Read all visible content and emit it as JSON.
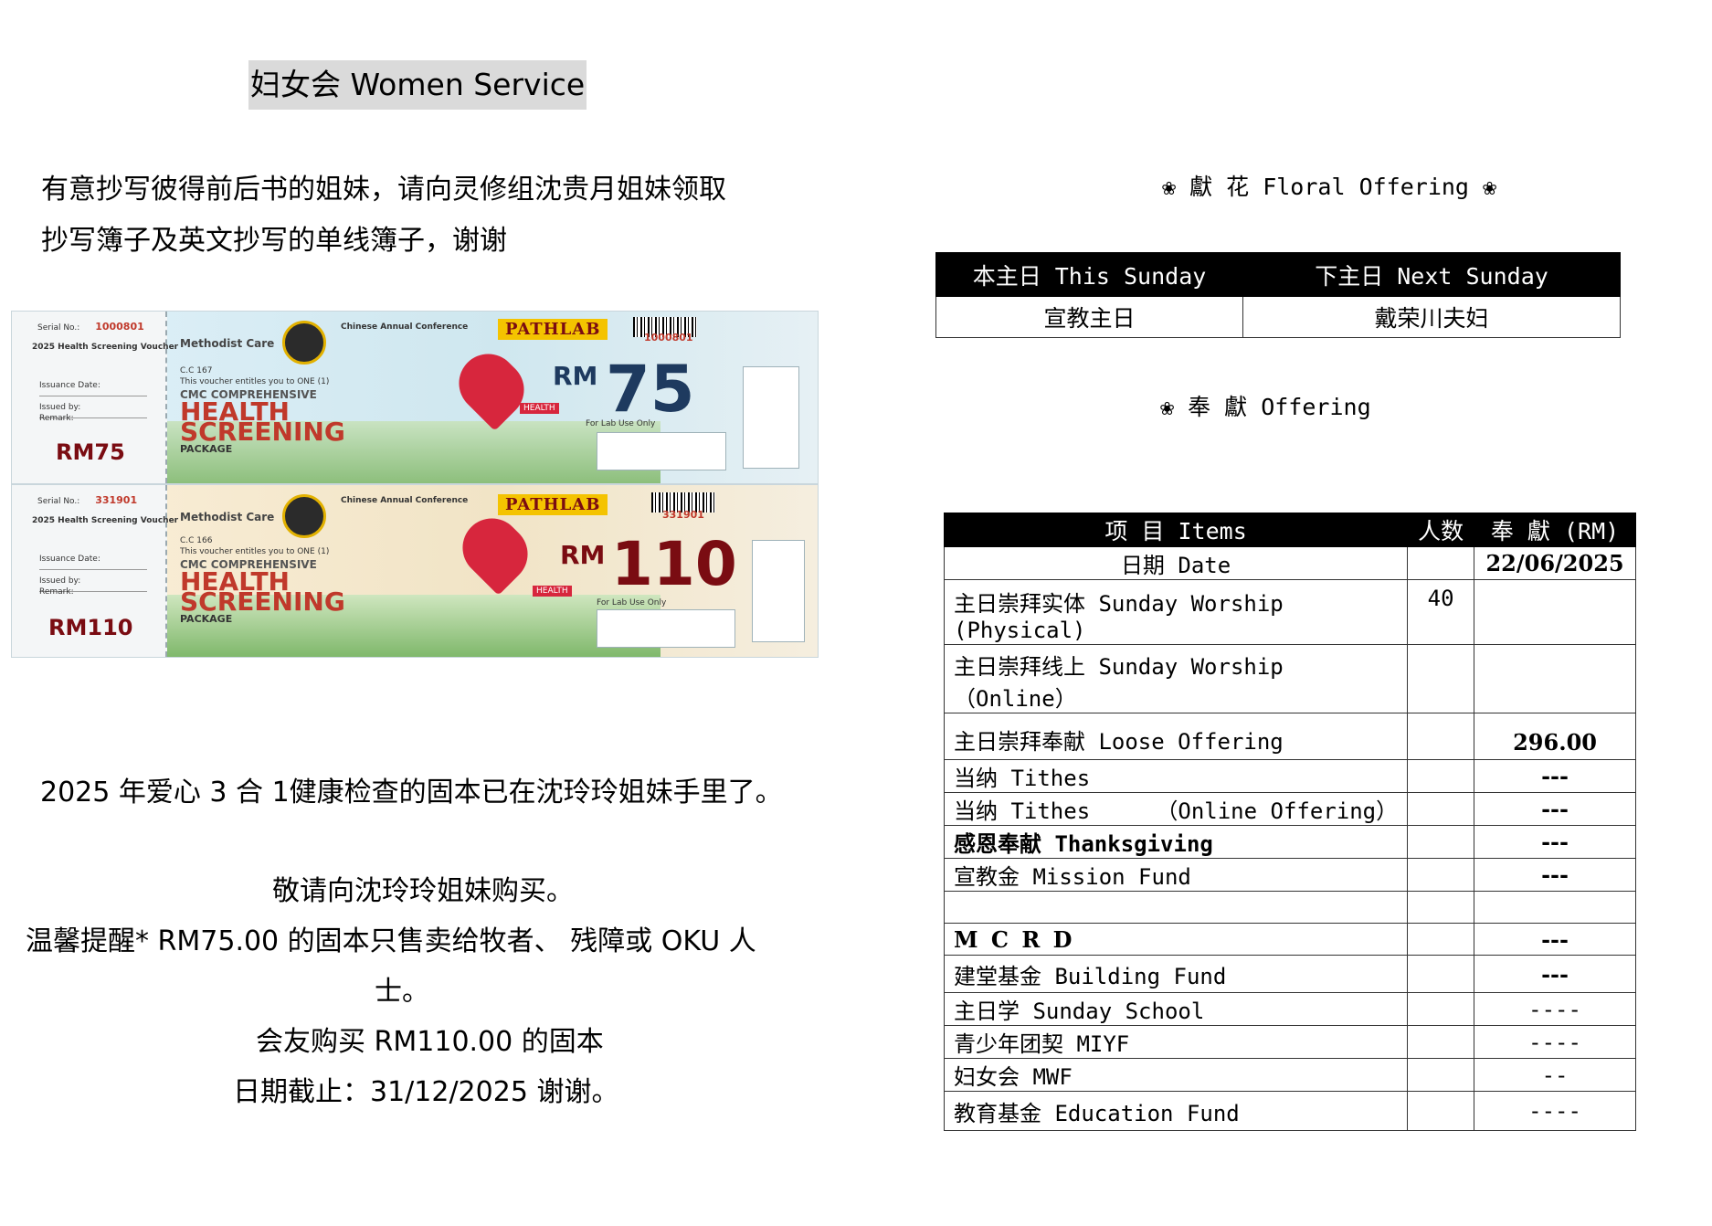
{
  "women_service": {
    "title": "妇女会  Women Service",
    "notice_line1": "有意抄写彼得前后书的姐妹，请向灵修组沈贵月姐妹领取",
    "notice_line2": "抄写簿子及英文抄写的单线簿子，谢谢",
    "health_line": "2025 年爱心  3  合  1健康检查的固本已在沈玲玲姐妹手里了。",
    "buy_line": "敬请向沈玲玲姐妹购买。",
    "reminder_line1": "温馨提醒* RM75.00 的固本只售卖给牧者、  残障或  OKU  人",
    "reminder_line2": "士。",
    "member_line": "会友购买  RM110.00  的固本",
    "deadline_line": "日期截止：31/12/2025     谢谢。"
  },
  "vouchers": [
    {
      "serial_label": "Serial No.:",
      "serial": "1000801",
      "voucher_title": "2025 Health Screening Voucher",
      "stub_fields": [
        "Issuance Date:",
        "Issued by:",
        "Remark:"
      ],
      "brand": "Methodist Care",
      "conference": "Chinese Annual Conference",
      "code": "C.C 167",
      "entitles": "This voucher entitles you to ONE (1)",
      "cmc": "CMC COMPREHENSIVE",
      "health": "HEALTH",
      "screening": "SCREENING",
      "package": "PACKAGE",
      "lab": "PATHLAB",
      "rm": "RM",
      "amount": "75",
      "stub_amount": "RM75",
      "serial_right": "1000801",
      "lab_use": "For Lab Use Only",
      "badge": "HEALTH"
    },
    {
      "serial_label": "Serial No.:",
      "serial": "331901",
      "voucher_title": "2025 Health Screening Voucher",
      "stub_fields": [
        "Issuance Date:",
        "Issued by:",
        "Remark:"
      ],
      "brand": "Methodist Care",
      "conference": "Chinese Annual Conference",
      "code": "C.C 166",
      "entitles": "This voucher entitles you to ONE (1)",
      "cmc": "CMC COMPREHENSIVE",
      "health": "HEALTH",
      "screening": "SCREENING",
      "package": "PACKAGE",
      "lab": "PATHLAB",
      "rm": "RM",
      "amount": "110",
      "stub_amount": "RM110",
      "serial_right": "331901",
      "lab_use": "For Lab Use Only",
      "badge": "HEALTH"
    }
  ],
  "floral": {
    "heading": "❀ 獻 花 Floral Offering ❀",
    "headers": [
      "本主日 This Sunday",
      "下主日 Next Sunday"
    ],
    "values": [
      "宣教主日",
      "戴荣川夫妇"
    ]
  },
  "offering": {
    "heading": "❀  奉 獻  Offering",
    "headers": [
      "项 目 Items",
      "人数",
      "奉 獻 (RM)"
    ],
    "rows": [
      {
        "item": "日期 Date",
        "count": "",
        "amount": "22/06/2025"
      },
      {
        "item": "主日崇拜实体 Sunday Worship (Physical)",
        "count": "40",
        "amount": ""
      },
      {
        "item": "主日崇拜线上 Sunday Worship （Online）",
        "count": "",
        "amount": ""
      },
      {
        "item": "主日崇拜奉献 Loose Offering",
        "count": "",
        "amount": "296.00"
      },
      {
        "item": "当纳 Tithes",
        "count": "",
        "amount": "---"
      },
      {
        "item": "当纳 Tithes     （Online Offering）",
        "count": "",
        "amount": "---"
      },
      {
        "item": "感恩奉献 Thanksgiving",
        "count": "",
        "amount": "---"
      },
      {
        "item": "宣教金 Mission Fund",
        "count": "",
        "amount": "---"
      },
      {
        "item": "",
        "count": "",
        "amount": ""
      },
      {
        "item": "M C R D",
        "count": "",
        "amount": "---"
      },
      {
        "item": "建堂基金 Building Fund",
        "count": "",
        "amount": "---"
      },
      {
        "item": "主日学 Sunday School",
        "count": "",
        "amount": "----"
      },
      {
        "item": "青少年团契 MIYF",
        "count": "",
        "amount": "----"
      },
      {
        "item": "妇女会 MWF",
        "count": "",
        "amount": "--"
      },
      {
        "item": "教育基金 Education Fund",
        "count": "",
        "amount": "----"
      }
    ]
  }
}
